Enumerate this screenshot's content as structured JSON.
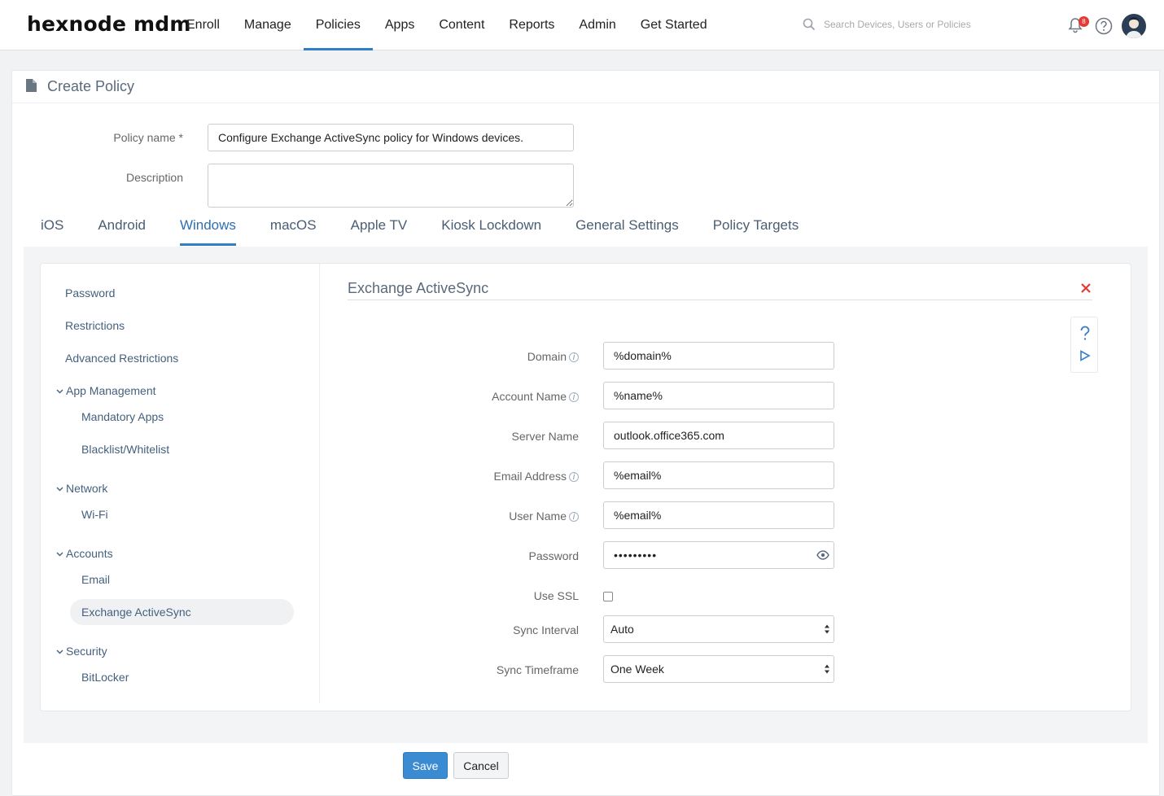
{
  "brand": {
    "logo": "hexnode mdm"
  },
  "nav": {
    "items": [
      "Enroll",
      "Manage",
      "Policies",
      "Apps",
      "Content",
      "Reports",
      "Admin",
      "Get Started"
    ],
    "active": "Policies"
  },
  "search": {
    "placeholder": "Search Devices, Users or Policies"
  },
  "notifications": {
    "count": "8"
  },
  "page": {
    "title": "Create Policy"
  },
  "policy": {
    "name_label": "Policy name *",
    "name_value": "Configure Exchange ActiveSync policy for Windows devices.",
    "description_label": "Description",
    "description_value": ""
  },
  "tabs": [
    "iOS",
    "Android",
    "Windows",
    "macOS",
    "Apple TV",
    "Kiosk Lockdown",
    "General Settings",
    "Policy Targets"
  ],
  "active_tab": "Windows",
  "sidebar": {
    "items": [
      {
        "label": "Password"
      },
      {
        "label": "Restrictions"
      },
      {
        "label": "Advanced Restrictions"
      }
    ],
    "groups": [
      {
        "label": "App Management",
        "children": [
          "Mandatory Apps",
          "Blacklist/Whitelist"
        ]
      },
      {
        "label": "Network",
        "children": [
          "Wi-Fi"
        ]
      },
      {
        "label": "Accounts",
        "children": [
          "Email",
          "Exchange ActiveSync"
        ]
      },
      {
        "label": "Security",
        "children": [
          "BitLocker"
        ]
      }
    ],
    "selected": "Exchange ActiveSync"
  },
  "section": {
    "title": "Exchange ActiveSync"
  },
  "form": {
    "domain": {
      "label": "Domain",
      "value": "%domain%"
    },
    "account_name": {
      "label": "Account Name",
      "value": "%name%"
    },
    "server_name": {
      "label": "Server Name",
      "value": "outlook.office365.com"
    },
    "email_address": {
      "label": "Email Address",
      "value": "%email%"
    },
    "user_name": {
      "label": "User Name",
      "value": "%email%"
    },
    "password": {
      "label": "Password",
      "value": "•••••••••"
    },
    "use_ssl": {
      "label": "Use SSL",
      "checked": false
    },
    "sync_interval": {
      "label": "Sync Interval",
      "value": "Auto"
    },
    "sync_timeframe": {
      "label": "Sync Timeframe",
      "value": "One Week"
    }
  },
  "buttons": {
    "save": "Save",
    "cancel": "Cancel"
  },
  "colors": {
    "accent": "#2e7fc6",
    "save_button": "#3a8bd1",
    "close": "#e53935",
    "badge": "#e53935"
  }
}
